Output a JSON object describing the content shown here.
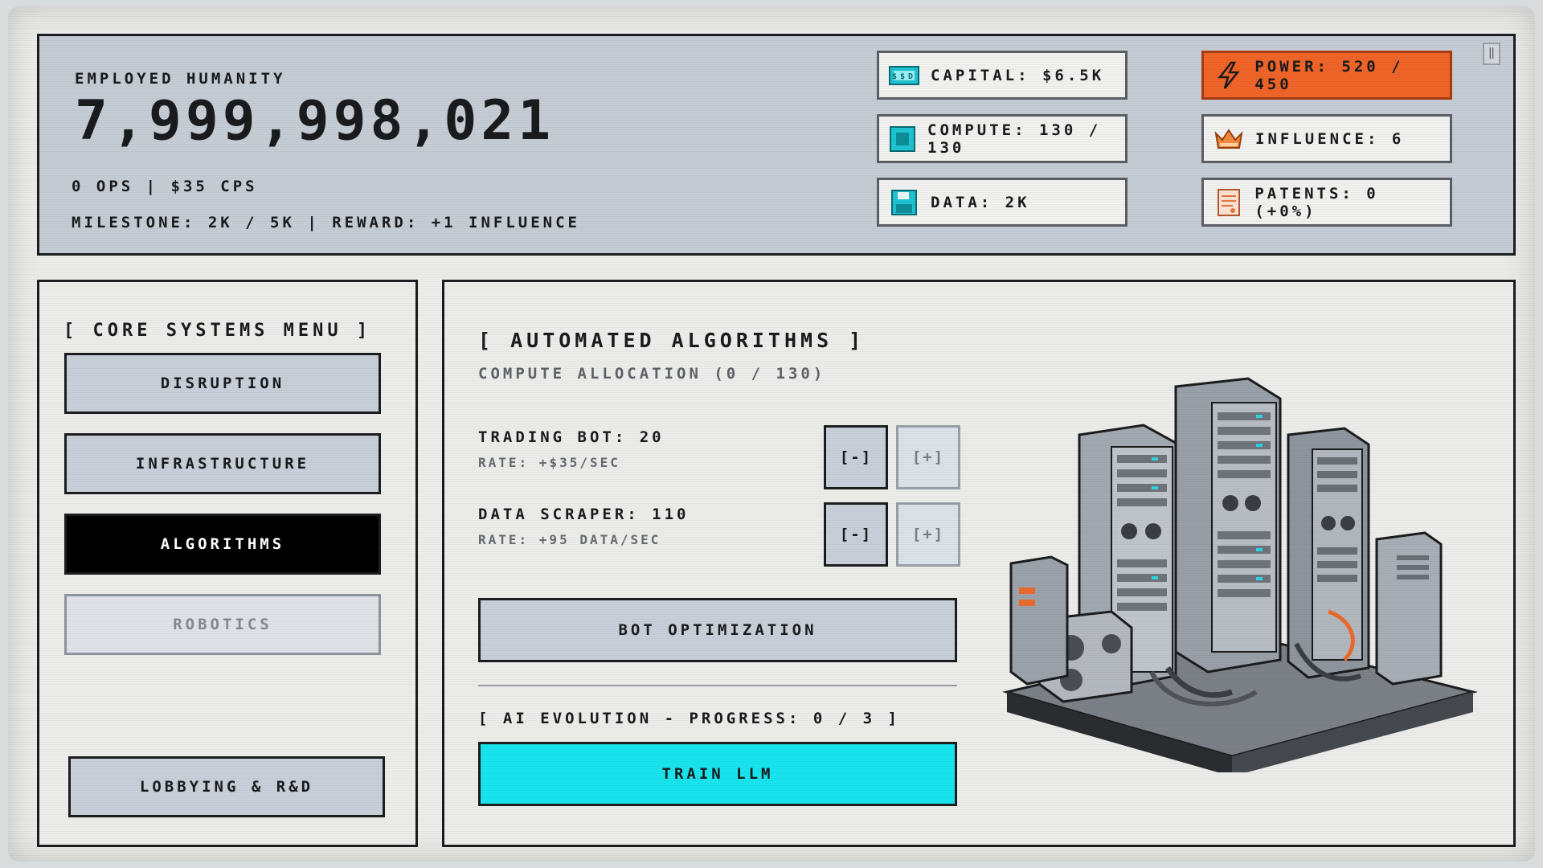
{
  "header": {
    "population_label": "EMPLOYED HUMANITY",
    "population_value": "7,999,998,021",
    "rates": "0 OPS | $35 CPS",
    "milestone": "MILESTONE: 2K / 5K | REWARD: +1 INFLUENCE"
  },
  "resources": {
    "capital": "CAPITAL: $6.5K",
    "compute": "COMPUTE: 130 / 130",
    "data": "DATA: 2K",
    "power": "POWER: 520 / 450",
    "influence": "INFLUENCE: 6",
    "patents": "PATENTS: 0 (+0%)",
    "capital_icon_text": "$$D"
  },
  "menu": {
    "title": "[ CORE SYSTEMS MENU ]",
    "items": [
      {
        "label": "DISRUPTION"
      },
      {
        "label": "INFRASTRUCTURE"
      },
      {
        "label": "ALGORITHMS"
      },
      {
        "label": "ROBOTICS"
      }
    ],
    "lobbying": "LOBBYING & R&D",
    "active_item": "ALGORITHMS",
    "disabled_item": "ROBOTICS"
  },
  "main": {
    "title": "[ AUTOMATED ALGORITHMS ]",
    "allocation": "COMPUTE ALLOCATION (0 / 130)",
    "bots": [
      {
        "name": "TRADING BOT: 20",
        "rate": "RATE: +$35/SEC"
      },
      {
        "name": "DATA SCRAPER: 110",
        "rate": "RATE: +95 DATA/SEC"
      }
    ],
    "minus_label": "[-]",
    "plus_label": "[+]",
    "optimization_button": "BOT OPTIMIZATION",
    "evolution": "[ AI EVOLUTION - PROGRESS: 0 / 3 ]",
    "train_button": "TRAIN LLM"
  },
  "colors": {
    "power_accent": "#ef6428",
    "train_accent": "#18e4ee",
    "active_menu": "#000000"
  },
  "icons": [
    "money-icon",
    "cpu-chip-icon",
    "floppy-disk-icon",
    "lightning-icon",
    "crown-icon",
    "patent-document-icon",
    "pause-icon",
    "server-rack-illustration"
  ]
}
